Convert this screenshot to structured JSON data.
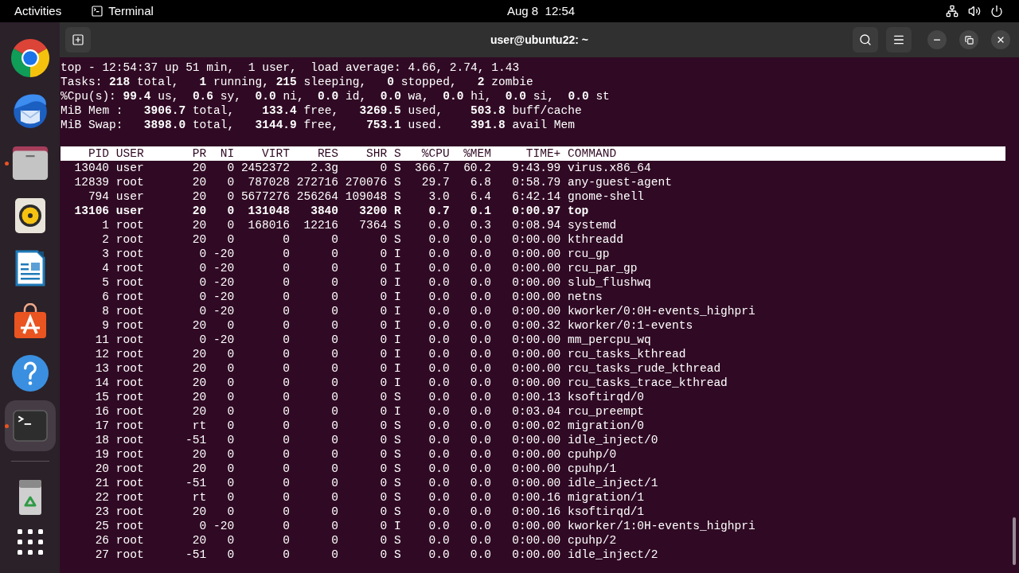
{
  "top_bar": {
    "activities": "Activities",
    "app": "Terminal",
    "clock": "Aug 8  12:54"
  },
  "dock": {
    "apps": [
      {
        "running": false,
        "selected": false
      },
      {
        "running": false,
        "selected": false
      },
      {
        "running": true,
        "selected": false
      },
      {
        "running": false,
        "selected": false
      },
      {
        "running": false,
        "selected": false
      },
      {
        "running": false,
        "selected": false
      },
      {
        "running": false,
        "selected": false
      },
      {
        "running": true,
        "selected": true
      }
    ]
  },
  "window": {
    "title": "user@ubuntu22: ~"
  },
  "terminal": {
    "summary": [
      "top - 12:54:37 up 51 min,  1 user,  load average: 4.66, 2.74, 1.43",
      "Tasks: **218** total,   **1** running, **215** sleeping,   **0** stopped,   **2** zombie",
      "%Cpu(s): **99.4** us,  **0.6** sy,  **0.0** ni,  **0.0** id,  **0.0** wa,  **0.0** hi,  **0.0** si,  **0.0** st",
      "MiB Mem :   **3906.7** total,    **133.4** free,   **3269.5** used,    **503.8** buff/cache",
      "MiB Swap:   **3898.0** total,   **3144.9** free,    **753.1** used.    **391.8** avail Mem"
    ],
    "columns": [
      "PID",
      "USER",
      "PR",
      "NI",
      "VIRT",
      "RES",
      "SHR",
      "S",
      "%CPU",
      "%MEM",
      "TIME+",
      "COMMAND"
    ],
    "rows": [
      {
        "cells": [
          "13040",
          "user",
          "20",
          "0",
          "2452372",
          "2.3g",
          "0",
          "S",
          "366.7",
          "60.2",
          "9:43.99",
          "virus.x86_64"
        ],
        "highlighted": false
      },
      {
        "cells": [
          "12839",
          "root",
          "20",
          "0",
          "787028",
          "272716",
          "270076",
          "S",
          "29.7",
          "6.8",
          "0:58.79",
          "any-guest-agent"
        ],
        "highlighted": false
      },
      {
        "cells": [
          "794",
          "user",
          "20",
          "0",
          "5677276",
          "256264",
          "109048",
          "S",
          "3.0",
          "6.4",
          "6:42.14",
          "gnome-shell"
        ],
        "highlighted": false
      },
      {
        "cells": [
          "13106",
          "user",
          "20",
          "0",
          "131048",
          "3840",
          "3200",
          "R",
          "0.7",
          "0.1",
          "0:00.97",
          "top"
        ],
        "highlighted": true
      },
      {
        "cells": [
          "1",
          "root",
          "20",
          "0",
          "168016",
          "12216",
          "7364",
          "S",
          "0.0",
          "0.3",
          "0:08.94",
          "systemd"
        ],
        "highlighted": false
      },
      {
        "cells": [
          "2",
          "root",
          "20",
          "0",
          "0",
          "0",
          "0",
          "S",
          "0.0",
          "0.0",
          "0:00.00",
          "kthreadd"
        ],
        "highlighted": false
      },
      {
        "cells": [
          "3",
          "root",
          "0",
          "-20",
          "0",
          "0",
          "0",
          "I",
          "0.0",
          "0.0",
          "0:00.00",
          "rcu_gp"
        ],
        "highlighted": false
      },
      {
        "cells": [
          "4",
          "root",
          "0",
          "-20",
          "0",
          "0",
          "0",
          "I",
          "0.0",
          "0.0",
          "0:00.00",
          "rcu_par_gp"
        ],
        "highlighted": false
      },
      {
        "cells": [
          "5",
          "root",
          "0",
          "-20",
          "0",
          "0",
          "0",
          "I",
          "0.0",
          "0.0",
          "0:00.00",
          "slub_flushwq"
        ],
        "highlighted": false
      },
      {
        "cells": [
          "6",
          "root",
          "0",
          "-20",
          "0",
          "0",
          "0",
          "I",
          "0.0",
          "0.0",
          "0:00.00",
          "netns"
        ],
        "highlighted": false
      },
      {
        "cells": [
          "8",
          "root",
          "0",
          "-20",
          "0",
          "0",
          "0",
          "I",
          "0.0",
          "0.0",
          "0:00.00",
          "kworker/0:0H-events_highpri"
        ],
        "highlighted": false
      },
      {
        "cells": [
          "9",
          "root",
          "20",
          "0",
          "0",
          "0",
          "0",
          "I",
          "0.0",
          "0.0",
          "0:00.32",
          "kworker/0:1-events"
        ],
        "highlighted": false
      },
      {
        "cells": [
          "11",
          "root",
          "0",
          "-20",
          "0",
          "0",
          "0",
          "I",
          "0.0",
          "0.0",
          "0:00.00",
          "mm_percpu_wq"
        ],
        "highlighted": false
      },
      {
        "cells": [
          "12",
          "root",
          "20",
          "0",
          "0",
          "0",
          "0",
          "I",
          "0.0",
          "0.0",
          "0:00.00",
          "rcu_tasks_kthread"
        ],
        "highlighted": false
      },
      {
        "cells": [
          "13",
          "root",
          "20",
          "0",
          "0",
          "0",
          "0",
          "I",
          "0.0",
          "0.0",
          "0:00.00",
          "rcu_tasks_rude_kthread"
        ],
        "highlighted": false
      },
      {
        "cells": [
          "14",
          "root",
          "20",
          "0",
          "0",
          "0",
          "0",
          "I",
          "0.0",
          "0.0",
          "0:00.00",
          "rcu_tasks_trace_kthread"
        ],
        "highlighted": false
      },
      {
        "cells": [
          "15",
          "root",
          "20",
          "0",
          "0",
          "0",
          "0",
          "S",
          "0.0",
          "0.0",
          "0:00.13",
          "ksoftirqd/0"
        ],
        "highlighted": false
      },
      {
        "cells": [
          "16",
          "root",
          "20",
          "0",
          "0",
          "0",
          "0",
          "I",
          "0.0",
          "0.0",
          "0:03.04",
          "rcu_preempt"
        ],
        "highlighted": false
      },
      {
        "cells": [
          "17",
          "root",
          "rt",
          "0",
          "0",
          "0",
          "0",
          "S",
          "0.0",
          "0.0",
          "0:00.02",
          "migration/0"
        ],
        "highlighted": false
      },
      {
        "cells": [
          "18",
          "root",
          "-51",
          "0",
          "0",
          "0",
          "0",
          "S",
          "0.0",
          "0.0",
          "0:00.00",
          "idle_inject/0"
        ],
        "highlighted": false
      },
      {
        "cells": [
          "19",
          "root",
          "20",
          "0",
          "0",
          "0",
          "0",
          "S",
          "0.0",
          "0.0",
          "0:00.00",
          "cpuhp/0"
        ],
        "highlighted": false
      },
      {
        "cells": [
          "20",
          "root",
          "20",
          "0",
          "0",
          "0",
          "0",
          "S",
          "0.0",
          "0.0",
          "0:00.00",
          "cpuhp/1"
        ],
        "highlighted": false
      },
      {
        "cells": [
          "21",
          "root",
          "-51",
          "0",
          "0",
          "0",
          "0",
          "S",
          "0.0",
          "0.0",
          "0:00.00",
          "idle_inject/1"
        ],
        "highlighted": false
      },
      {
        "cells": [
          "22",
          "root",
          "rt",
          "0",
          "0",
          "0",
          "0",
          "S",
          "0.0",
          "0.0",
          "0:00.16",
          "migration/1"
        ],
        "highlighted": false
      },
      {
        "cells": [
          "23",
          "root",
          "20",
          "0",
          "0",
          "0",
          "0",
          "S",
          "0.0",
          "0.0",
          "0:00.16",
          "ksoftirqd/1"
        ],
        "highlighted": false
      },
      {
        "cells": [
          "25",
          "root",
          "0",
          "-20",
          "0",
          "0",
          "0",
          "I",
          "0.0",
          "0.0",
          "0:00.00",
          "kworker/1:0H-events_highpri"
        ],
        "highlighted": false
      },
      {
        "cells": [
          "26",
          "root",
          "20",
          "0",
          "0",
          "0",
          "0",
          "S",
          "0.0",
          "0.0",
          "0:00.00",
          "cpuhp/2"
        ],
        "highlighted": false
      },
      {
        "cells": [
          "27",
          "root",
          "-51",
          "0",
          "0",
          "0",
          "0",
          "S",
          "0.0",
          "0.0",
          "0:00.00",
          "idle_inject/2"
        ],
        "highlighted": false
      }
    ]
  }
}
